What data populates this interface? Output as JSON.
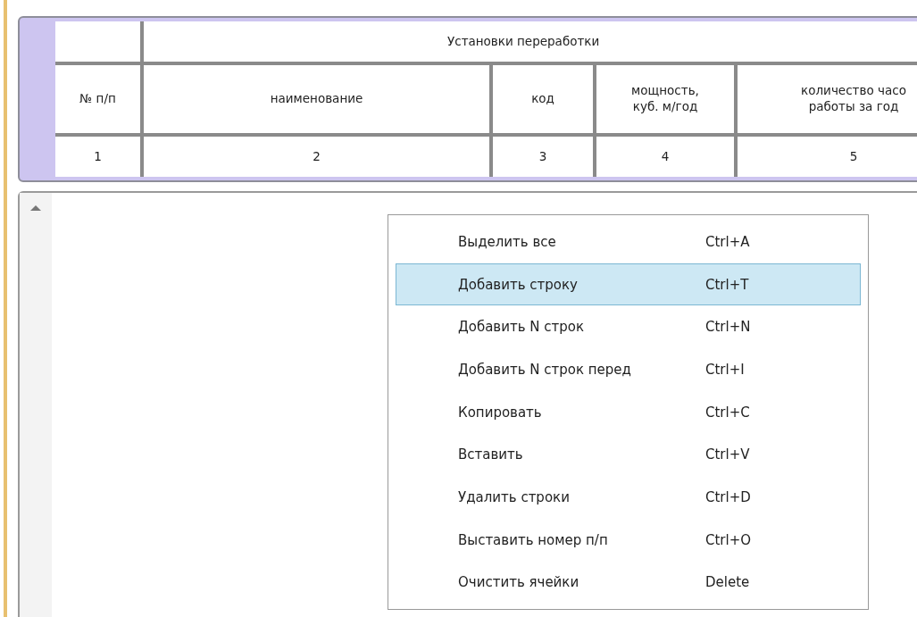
{
  "table": {
    "group_header": "Установки переработки",
    "columns": [
      {
        "lines": [
          "№ п/п"
        ]
      },
      {
        "lines": [
          "наименование"
        ]
      },
      {
        "lines": [
          "код"
        ]
      },
      {
        "lines": [
          "мощность,",
          "куб. м/год"
        ]
      },
      {
        "lines": [
          "количество часо",
          "работы за год"
        ]
      }
    ],
    "numbers": [
      "1",
      "2",
      "3",
      "4",
      "5"
    ]
  },
  "context_menu": {
    "items": [
      {
        "label": "Выделить все",
        "shortcut": "Ctrl+A",
        "selected": false
      },
      {
        "label": "Добавить строку",
        "shortcut": "Ctrl+T",
        "selected": true
      },
      {
        "label": "Добавить N строк",
        "shortcut": "Ctrl+N",
        "selected": false
      },
      {
        "label": "Добавить N строк перед",
        "shortcut": "Ctrl+I",
        "selected": false
      },
      {
        "label": "Копировать",
        "shortcut": "Ctrl+C",
        "selected": false
      },
      {
        "label": "Вставить",
        "shortcut": "Ctrl+V",
        "selected": false
      },
      {
        "label": "Удалить строки",
        "shortcut": "Ctrl+D",
        "selected": false
      },
      {
        "label": "Выставить номер п/п",
        "shortcut": "Ctrl+O",
        "selected": false
      },
      {
        "label": "Очистить ячейки",
        "shortcut": "Delete",
        "selected": false
      }
    ]
  }
}
